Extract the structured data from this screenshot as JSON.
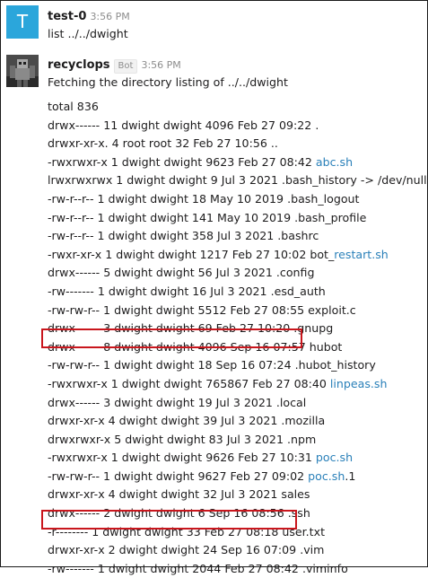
{
  "messages": {
    "m1": {
      "avatar_letter": "T",
      "user": "test-0",
      "time": "3:56 PM",
      "text": "list ../../dwight"
    },
    "m2": {
      "user": "recyclops",
      "badge": "Bot",
      "time": "3:56 PM",
      "text": "Fetching the directory listing of ../../dwight"
    }
  },
  "listing": {
    "total": "total 836",
    "rows": [
      {
        "text": "drwx------ 11 dwight dwight 4096 Feb 27 09:22 ."
      },
      {
        "text": "drwxr-xr-x. 4 root root 32 Feb 27 10:56 .."
      },
      {
        "text": "-rwxrwxr-x 1 dwight dwight 9623 Feb 27 08:42 ",
        "link": "abc.sh"
      },
      {
        "text": "lrwxrwxrwx 1 dwight dwight 9 Jul 3 2021 .bash_history -> /dev/null"
      },
      {
        "text": "-rw-r--r-- 1 dwight dwight 18 May 10 2019 .bash_logout"
      },
      {
        "text": "-rw-r--r-- 1 dwight dwight 141 May 10 2019 .bash_profile"
      },
      {
        "text": "-rw-r--r-- 1 dwight dwight 358 Jul 3 2021 .bashrc"
      },
      {
        "text": "-rwxr-xr-x 1 dwight dwight 1217 Feb 27 10:02 bot_",
        "link": "restart.sh"
      },
      {
        "text": "drwx------ 5 dwight dwight 56 Jul 3 2021 .config"
      },
      {
        "text": "-rw------- 1 dwight dwight 16 Jul 3 2021 .esd_auth"
      },
      {
        "text": "-rw-rw-r-- 1 dwight dwight 5512 Feb 27 08:55 exploit.c"
      },
      {
        "text": "drwx------ 3 dwight dwight 69 Feb 27 10:20 .gnupg"
      },
      {
        "text": "drwx------ 8 dwight dwight 4096 Sep 16 07:57 hubot"
      },
      {
        "text": "-rw-rw-r-- 1 dwight dwight 18 Sep 16 07:24 .hubot_history"
      },
      {
        "text": "-rwxrwxr-x 1 dwight dwight 765867 Feb 27 08:40 ",
        "link": "linpeas.sh"
      },
      {
        "text": "drwx------ 3 dwight dwight 19 Jul 3 2021 .local"
      },
      {
        "text": "drwxr-xr-x 4 dwight dwight 39 Jul 3 2021 .mozilla"
      },
      {
        "text": "drwxrwxr-x 5 dwight dwight 83 Jul 3 2021 .npm"
      },
      {
        "text": "-rwxrwxr-x 1 dwight dwight 9626 Feb 27 10:31 ",
        "link": "poc.sh"
      },
      {
        "text": "-rw-rw-r-- 1 dwight dwight 9627 Feb 27 09:02 ",
        "link": "poc.sh",
        "suffix": ".1"
      },
      {
        "text": "drwxr-xr-x 4 dwight dwight 32 Jul 3 2021 sales"
      },
      {
        "text": "drwx------ 2 dwight dwight 6 Sep 16 08:56 .ssh"
      },
      {
        "text": "-r-------- 1 dwight dwight 33 Feb 27 08:18 user.txt"
      },
      {
        "text": "drwxr-xr-x 2 dwight dwight 24 Sep 16 07:09 .vim"
      },
      {
        "text": "-rw------- 1 dwight dwight 2044 Feb 27 08:42 .viminfo"
      }
    ]
  },
  "colors": {
    "link": "#2a80b9",
    "highlight": "#c9161d",
    "avatar_t": "#2ba6db"
  },
  "icons": {
    "recyclops_avatar": "robot-avatar-icon"
  }
}
